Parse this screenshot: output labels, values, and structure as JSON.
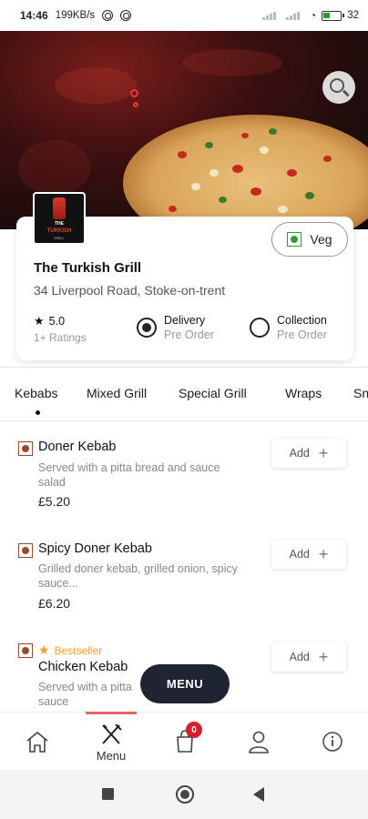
{
  "status_bar": {
    "time": "14:46",
    "speed": "199KB/s",
    "battery": "32"
  },
  "restaurant": {
    "name": "The Turkish Grill",
    "address": "34 Liverpool Road, Stoke-on-trent",
    "rating": "5.0",
    "ratings_count": "1+ Ratings",
    "logo_text": {
      "line1": "THE",
      "line2": "TURKISH",
      "line3": "GRILL"
    }
  },
  "veg_toggle": {
    "label": "Veg",
    "color": "#2e9c39"
  },
  "order_options": [
    {
      "label": "Delivery",
      "sub": "Pre Order",
      "selected": true
    },
    {
      "label": "Collection",
      "sub": "Pre Order",
      "selected": false
    }
  ],
  "categories": [
    "Kebabs",
    "Mixed Grill",
    "Special Grill",
    "Wraps",
    "Sn"
  ],
  "active_category": "Kebabs",
  "items": [
    {
      "name": "Doner Kebab",
      "desc_line1": "Served with a pitta bread and sauce",
      "desc_line2": "salad",
      "price": "£5.20",
      "add_label": "Add",
      "tag": ""
    },
    {
      "name": "Spicy Doner Kebab",
      "desc_line1": "Grilled doner kebab, grilled onion, spicy",
      "desc_line2": "sauce...",
      "price": "£6.20",
      "add_label": "Add",
      "tag": ""
    },
    {
      "name": "Chicken Kebab",
      "desc_line1": "Served with a pitta",
      "desc_line2": "sauce",
      "price": "",
      "add_label": "Add",
      "tag": "Bestseller"
    }
  ],
  "menu_fab": {
    "label": "MENU"
  },
  "bottom_nav": {
    "menu_label": "Menu",
    "cart_count": "0"
  },
  "colors": {
    "accent": "#e86363",
    "nonveg": "#9a4a2c",
    "bestseller": "#f0a030",
    "fab": "#1f2433",
    "badge": "#d0202a"
  }
}
